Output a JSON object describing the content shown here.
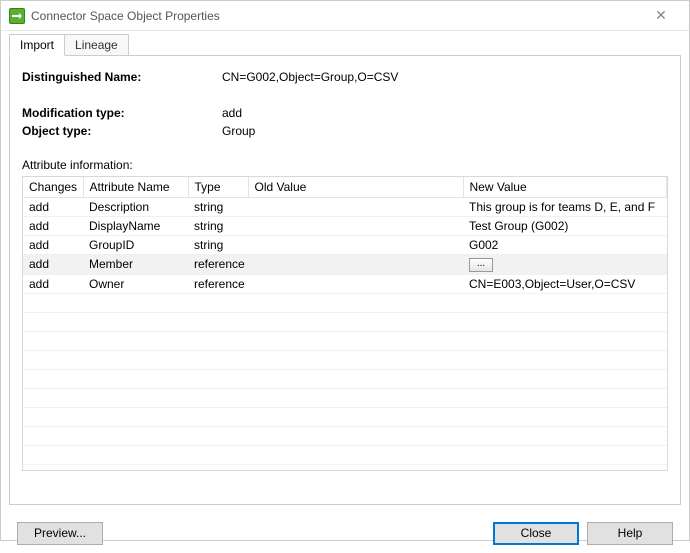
{
  "window": {
    "title": "Connector Space Object Properties"
  },
  "tabs": [
    {
      "label": "Import",
      "active": true
    },
    {
      "label": "Lineage",
      "active": false
    }
  ],
  "fields": {
    "dn_label": "Distinguished Name:",
    "dn_value": "CN=G002,Object=Group,O=CSV",
    "modtype_label": "Modification type:",
    "modtype_value": "add",
    "objtype_label": "Object type:",
    "objtype_value": "Group"
  },
  "attr_section_label": "Attribute information:",
  "grid": {
    "columns": [
      "Changes",
      "Attribute Name",
      "Type",
      "Old Value",
      "New Value"
    ],
    "rows": [
      {
        "changes": "add",
        "attr": "Description",
        "type": "string",
        "old": "",
        "new": "This group is for teams D, E, and F",
        "selected": false,
        "newIsButton": false
      },
      {
        "changes": "add",
        "attr": "DisplayName",
        "type": "string",
        "old": "",
        "new": "Test Group (G002)",
        "selected": false,
        "newIsButton": false
      },
      {
        "changes": "add",
        "attr": "GroupID",
        "type": "string",
        "old": "",
        "new": "G002",
        "selected": false,
        "newIsButton": false
      },
      {
        "changes": "add",
        "attr": "Member",
        "type": "reference",
        "old": "",
        "new": "...",
        "selected": true,
        "newIsButton": true
      },
      {
        "changes": "add",
        "attr": "Owner",
        "type": "reference",
        "old": "",
        "new": "CN=E003,Object=User,O=CSV",
        "selected": false,
        "newIsButton": false
      }
    ],
    "empty_rows": 9
  },
  "buttons": {
    "preview": "Preview...",
    "close": "Close",
    "help": "Help"
  }
}
